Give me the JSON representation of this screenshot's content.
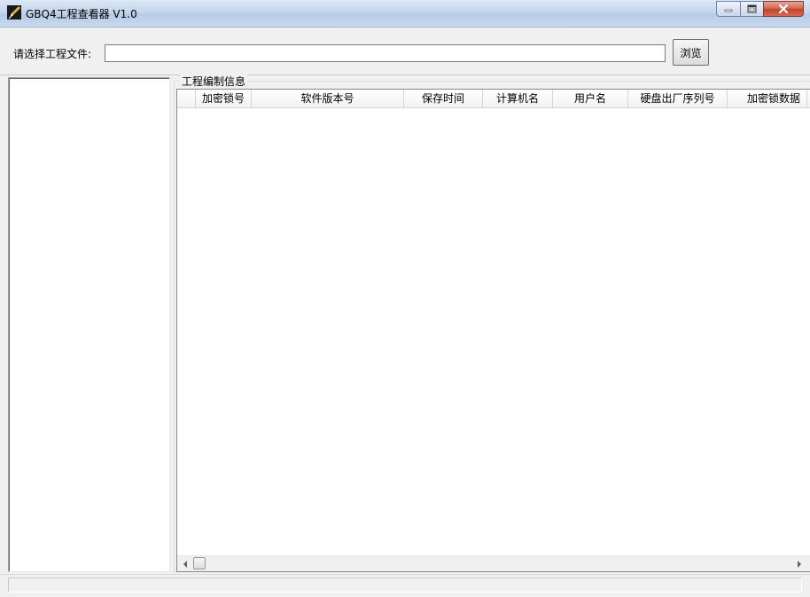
{
  "window": {
    "title": "GBQ4工程查看器 V1.0"
  },
  "file": {
    "label": "请选择工程文件:",
    "value": "",
    "browse_label": "浏览"
  },
  "info": {
    "group_title": "工程编制信息",
    "columns": [
      "",
      "加密锁号",
      "软件版本号",
      "保存时间",
      "计算机名",
      "用户名",
      "硬盘出厂序列号",
      "加密锁数据"
    ]
  }
}
